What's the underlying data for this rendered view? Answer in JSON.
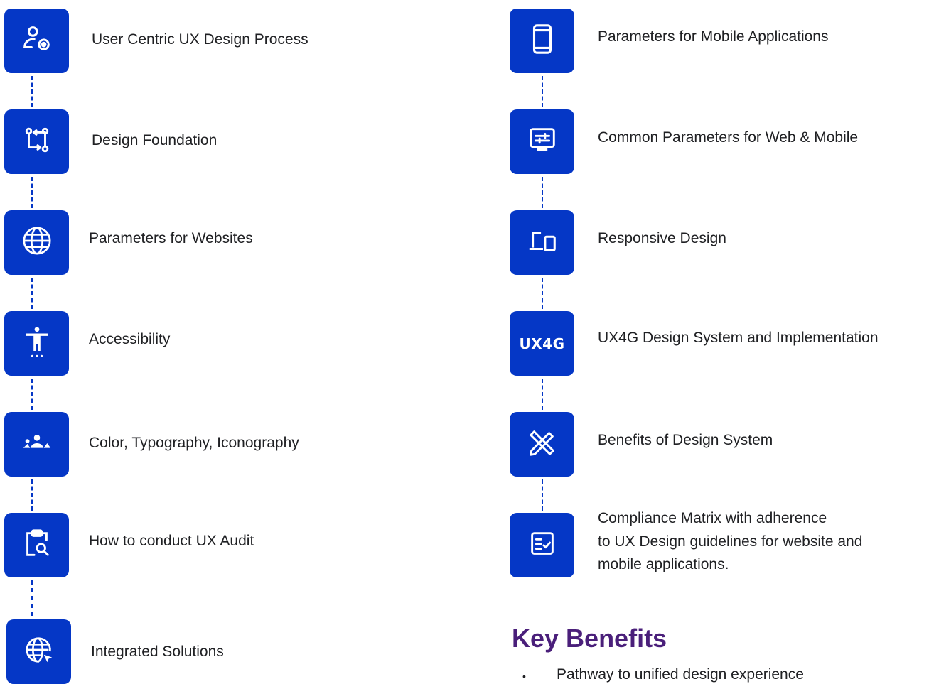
{
  "left_column": [
    {
      "label": "User Centric UX Design Process",
      "icon": "user-settings-icon"
    },
    {
      "label": "Design Foundation",
      "icon": "flow-icon"
    },
    {
      "label": "Parameters for Websites",
      "icon": "globe-icon"
    },
    {
      "label": "Accessibility",
      "icon": "accessibility-icon"
    },
    {
      "label": "Color, Typography, Iconography",
      "icon": "group-icon"
    },
    {
      "label": "How to conduct UX Audit",
      "icon": "clipboard-search-icon"
    },
    {
      "label": "Integrated Solutions",
      "icon": "globe-cursor-icon"
    }
  ],
  "right_column": [
    {
      "label": "Parameters for Mobile Applications",
      "icon": "mobile-icon"
    },
    {
      "label": "Common Parameters for Web & Mobile",
      "icon": "monitor-settings-icon"
    },
    {
      "label": "Responsive Design",
      "icon": "devices-icon"
    },
    {
      "label": "UX4G Design System and Implementation",
      "icon": "ux4g-logo",
      "tile_text": "UX4G"
    },
    {
      "label": "Benefits of Design System",
      "icon": "design-tools-icon"
    },
    {
      "label_lines": [
        "Compliance Matrix with adherence",
        "to UX Design guidelines for website and",
        "mobile applications."
      ],
      "icon": "checklist-icon"
    }
  ],
  "key_benefits": {
    "heading": "Key Benefits",
    "bullets": [
      "Pathway to unified design experience"
    ]
  },
  "colors": {
    "tile": "#0537c6",
    "heading": "#4a1f7a",
    "text": "#202124"
  }
}
